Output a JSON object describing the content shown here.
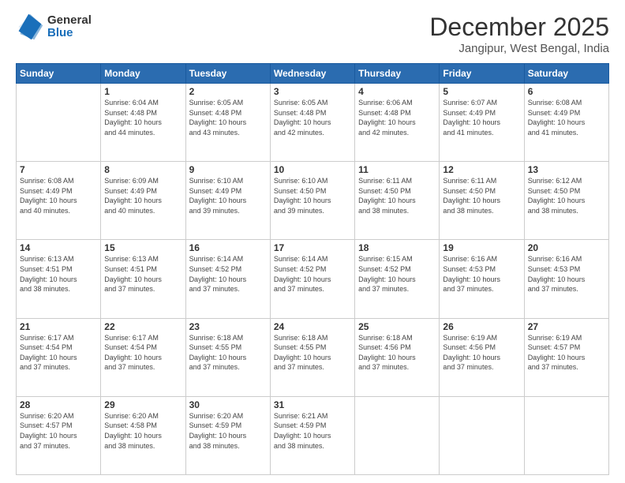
{
  "logo": {
    "general": "General",
    "blue": "Blue"
  },
  "header": {
    "month": "December 2025",
    "location": "Jangipur, West Bengal, India"
  },
  "days_of_week": [
    "Sunday",
    "Monday",
    "Tuesday",
    "Wednesday",
    "Thursday",
    "Friday",
    "Saturday"
  ],
  "weeks": [
    [
      {
        "day": "",
        "info": ""
      },
      {
        "day": "1",
        "info": "Sunrise: 6:04 AM\nSunset: 4:48 PM\nDaylight: 10 hours\nand 44 minutes."
      },
      {
        "day": "2",
        "info": "Sunrise: 6:05 AM\nSunset: 4:48 PM\nDaylight: 10 hours\nand 43 minutes."
      },
      {
        "day": "3",
        "info": "Sunrise: 6:05 AM\nSunset: 4:48 PM\nDaylight: 10 hours\nand 42 minutes."
      },
      {
        "day": "4",
        "info": "Sunrise: 6:06 AM\nSunset: 4:48 PM\nDaylight: 10 hours\nand 42 minutes."
      },
      {
        "day": "5",
        "info": "Sunrise: 6:07 AM\nSunset: 4:49 PM\nDaylight: 10 hours\nand 41 minutes."
      },
      {
        "day": "6",
        "info": "Sunrise: 6:08 AM\nSunset: 4:49 PM\nDaylight: 10 hours\nand 41 minutes."
      }
    ],
    [
      {
        "day": "7",
        "info": "Sunrise: 6:08 AM\nSunset: 4:49 PM\nDaylight: 10 hours\nand 40 minutes."
      },
      {
        "day": "8",
        "info": "Sunrise: 6:09 AM\nSunset: 4:49 PM\nDaylight: 10 hours\nand 40 minutes."
      },
      {
        "day": "9",
        "info": "Sunrise: 6:10 AM\nSunset: 4:49 PM\nDaylight: 10 hours\nand 39 minutes."
      },
      {
        "day": "10",
        "info": "Sunrise: 6:10 AM\nSunset: 4:50 PM\nDaylight: 10 hours\nand 39 minutes."
      },
      {
        "day": "11",
        "info": "Sunrise: 6:11 AM\nSunset: 4:50 PM\nDaylight: 10 hours\nand 38 minutes."
      },
      {
        "day": "12",
        "info": "Sunrise: 6:11 AM\nSunset: 4:50 PM\nDaylight: 10 hours\nand 38 minutes."
      },
      {
        "day": "13",
        "info": "Sunrise: 6:12 AM\nSunset: 4:50 PM\nDaylight: 10 hours\nand 38 minutes."
      }
    ],
    [
      {
        "day": "14",
        "info": "Sunrise: 6:13 AM\nSunset: 4:51 PM\nDaylight: 10 hours\nand 38 minutes."
      },
      {
        "day": "15",
        "info": "Sunrise: 6:13 AM\nSunset: 4:51 PM\nDaylight: 10 hours\nand 37 minutes."
      },
      {
        "day": "16",
        "info": "Sunrise: 6:14 AM\nSunset: 4:52 PM\nDaylight: 10 hours\nand 37 minutes."
      },
      {
        "day": "17",
        "info": "Sunrise: 6:14 AM\nSunset: 4:52 PM\nDaylight: 10 hours\nand 37 minutes."
      },
      {
        "day": "18",
        "info": "Sunrise: 6:15 AM\nSunset: 4:52 PM\nDaylight: 10 hours\nand 37 minutes."
      },
      {
        "day": "19",
        "info": "Sunrise: 6:16 AM\nSunset: 4:53 PM\nDaylight: 10 hours\nand 37 minutes."
      },
      {
        "day": "20",
        "info": "Sunrise: 6:16 AM\nSunset: 4:53 PM\nDaylight: 10 hours\nand 37 minutes."
      }
    ],
    [
      {
        "day": "21",
        "info": "Sunrise: 6:17 AM\nSunset: 4:54 PM\nDaylight: 10 hours\nand 37 minutes."
      },
      {
        "day": "22",
        "info": "Sunrise: 6:17 AM\nSunset: 4:54 PM\nDaylight: 10 hours\nand 37 minutes."
      },
      {
        "day": "23",
        "info": "Sunrise: 6:18 AM\nSunset: 4:55 PM\nDaylight: 10 hours\nand 37 minutes."
      },
      {
        "day": "24",
        "info": "Sunrise: 6:18 AM\nSunset: 4:55 PM\nDaylight: 10 hours\nand 37 minutes."
      },
      {
        "day": "25",
        "info": "Sunrise: 6:18 AM\nSunset: 4:56 PM\nDaylight: 10 hours\nand 37 minutes."
      },
      {
        "day": "26",
        "info": "Sunrise: 6:19 AM\nSunset: 4:56 PM\nDaylight: 10 hours\nand 37 minutes."
      },
      {
        "day": "27",
        "info": "Sunrise: 6:19 AM\nSunset: 4:57 PM\nDaylight: 10 hours\nand 37 minutes."
      }
    ],
    [
      {
        "day": "28",
        "info": "Sunrise: 6:20 AM\nSunset: 4:57 PM\nDaylight: 10 hours\nand 37 minutes."
      },
      {
        "day": "29",
        "info": "Sunrise: 6:20 AM\nSunset: 4:58 PM\nDaylight: 10 hours\nand 38 minutes."
      },
      {
        "day": "30",
        "info": "Sunrise: 6:20 AM\nSunset: 4:59 PM\nDaylight: 10 hours\nand 38 minutes."
      },
      {
        "day": "31",
        "info": "Sunrise: 6:21 AM\nSunset: 4:59 PM\nDaylight: 10 hours\nand 38 minutes."
      },
      {
        "day": "",
        "info": ""
      },
      {
        "day": "",
        "info": ""
      },
      {
        "day": "",
        "info": ""
      }
    ]
  ]
}
